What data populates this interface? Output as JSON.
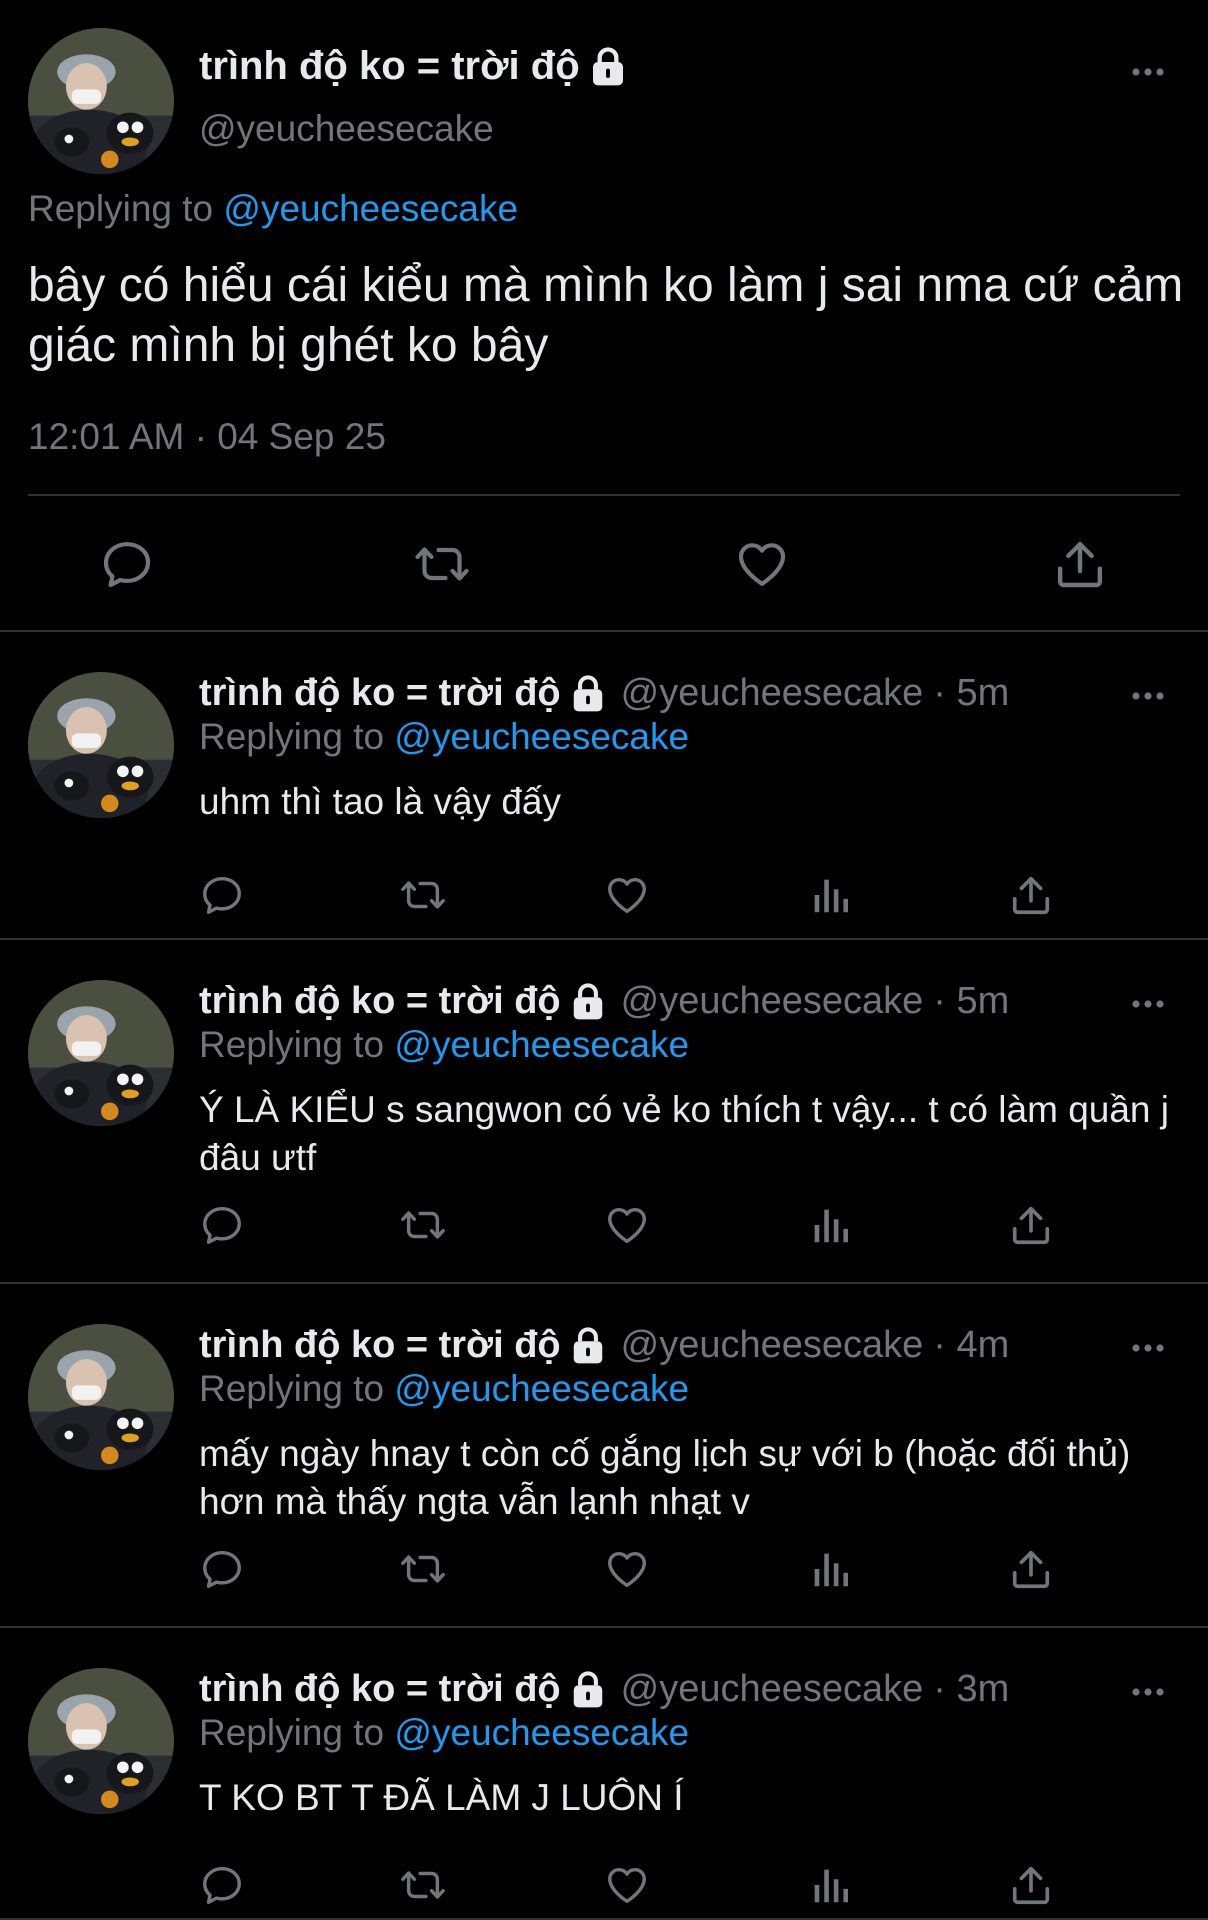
{
  "colors": {
    "background": "#000000",
    "text": "#e7e9ea",
    "secondary": "#71767b",
    "accent": "#1d9bf0",
    "divider": "#2f3336"
  },
  "main_tweet": {
    "display_name": "trình độ ko = trời độ",
    "handle": "@yeucheesecake",
    "replying_label": "Replying to",
    "replying_to": "@yeucheesecake",
    "text": "bây có hiểu cái kiểu mà mình ko làm j sai nma cứ cảm giác mình bị ghét ko bây",
    "timestamp": "12:01 AM · 04 Sep 25",
    "actions": [
      "reply-icon",
      "retweet-icon",
      "like-icon",
      "share-icon"
    ]
  },
  "replies": [
    {
      "display_name": "trình độ ko = trời độ",
      "handle": "@yeucheesecake",
      "time": "· 5m",
      "replying_label": "Replying to",
      "replying_to": "@yeucheesecake",
      "text": "uhm thì tao là vậy đấy"
    },
    {
      "display_name": "trình độ ko = trời độ",
      "handle": "@yeucheesecake",
      "time": "· 5m",
      "replying_label": "Replying to",
      "replying_to": "@yeucheesecake",
      "text": "Ý LÀ KIỂU s sangwon có vẻ ko thích t vậy... t có làm quần j đâu ưtf"
    },
    {
      "display_name": "trình độ ko = trời độ",
      "handle": "@yeucheesecake",
      "time": "· 4m",
      "replying_label": "Replying to",
      "replying_to": "@yeucheesecake",
      "text": "mấy ngày hnay t còn cố gắng lịch sự với b (hoặc đối thủ) hơn mà thấy ngta vẫn lạnh nhạt v"
    },
    {
      "display_name": "trình độ ko = trời độ",
      "handle": "@yeucheesecake",
      "time": "· 3m",
      "replying_label": "Replying to",
      "replying_to": "@yeucheesecake",
      "text": "T KO BT T ĐÃ LÀM J LUÔN Í"
    }
  ],
  "reply_actions": [
    "reply-icon",
    "retweet-icon",
    "like-icon",
    "views-icon",
    "share-icon"
  ]
}
